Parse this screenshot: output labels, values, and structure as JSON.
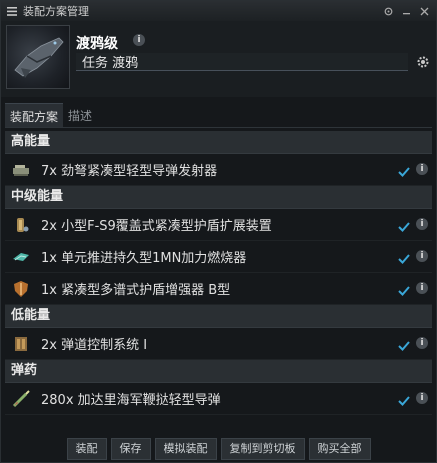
{
  "window": {
    "title": "装配方案管理"
  },
  "ship": {
    "name": "渡鸦级",
    "fitting_name": "任务 渡鸦"
  },
  "tabs": [
    {
      "label": "装配方案",
      "active": true
    },
    {
      "label": "描述",
      "active": false
    }
  ],
  "groups": {
    "high": {
      "title": "高能量",
      "items": [
        {
          "label": "7x 劲弩紧凑型轻型导弹发射器",
          "icon": "missile-launcher-icon"
        }
      ]
    },
    "mid": {
      "title": "中级能量",
      "items": [
        {
          "label": "2x 小型F-S9覆盖式紧凑型护盾扩展装置",
          "icon": "shield-extender-icon"
        },
        {
          "label": "1x 单元推进持久型1MN加力燃烧器",
          "icon": "afterburner-icon"
        },
        {
          "label": "1x 紧凑型多谱式护盾增强器 B型",
          "icon": "shield-hardener-icon"
        }
      ]
    },
    "low": {
      "title": "低能量",
      "items": [
        {
          "label": "2x 弹道控制系统 I",
          "icon": "ballistic-control-icon"
        }
      ]
    },
    "ammo": {
      "title": "弹药",
      "items": [
        {
          "label": "280x 加达里海军鞭挞轻型导弹",
          "icon": "light-missile-icon"
        }
      ]
    }
  },
  "footer": {
    "fit_label": "装配",
    "save_label": "保存",
    "simulate_label": "模拟装配",
    "copy_label": "复制到剪切板",
    "buy_all_label": "购买全部"
  },
  "colors": {
    "check": "#3aa7d8",
    "header_bg": "#2a2f33",
    "window_bg": "#15181b"
  }
}
